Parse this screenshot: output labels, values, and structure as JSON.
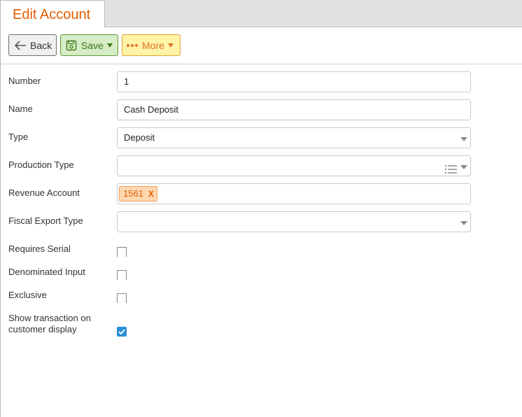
{
  "tab": {
    "title": "Edit Account"
  },
  "toolbar": {
    "back_label": "Back",
    "save_label": "Save",
    "more_label": "More"
  },
  "form": {
    "number": {
      "label": "Number",
      "value": "1"
    },
    "name": {
      "label": "Name",
      "value": "Cash Deposit"
    },
    "type": {
      "label": "Type",
      "value": "Deposit"
    },
    "production_type": {
      "label": "Production Type",
      "value": ""
    },
    "revenue_account": {
      "label": "Revenue Account",
      "tag": "1561",
      "remove": "X"
    },
    "fiscal_export_type": {
      "label": "Fiscal Export Type",
      "value": ""
    },
    "requires_serial": {
      "label": "Requires Serial",
      "checked": false
    },
    "denominated_input": {
      "label": "Denominated Input",
      "checked": false
    },
    "exclusive": {
      "label": "Exclusive",
      "checked": false
    },
    "show_transaction": {
      "label_line1": "Show transaction on",
      "label_line2": "customer display",
      "checked": true
    }
  },
  "colors": {
    "accent": "#e65c00",
    "save": "#3a7a1a",
    "more": "#e0702a",
    "checkbox_on": "#2a8fd8"
  }
}
